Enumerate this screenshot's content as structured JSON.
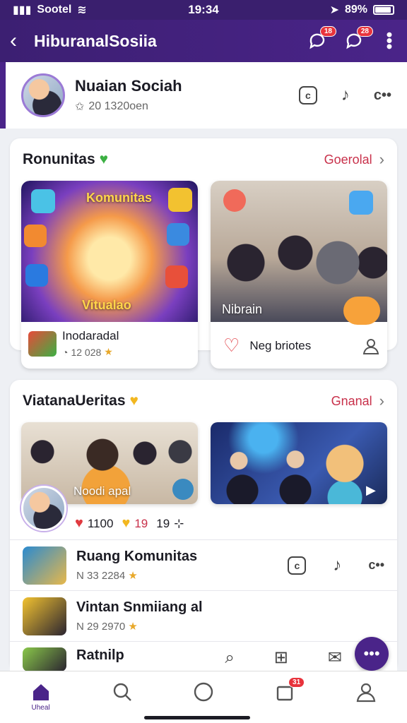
{
  "status_bar": {
    "carrier": "Sootel",
    "time": "19:34",
    "battery": "89%"
  },
  "app_bar": {
    "title": "HiburanalSosiia",
    "notif_badge_1": "18",
    "notif_badge_2": "28"
  },
  "profile": {
    "name": "Nuaian Sociah",
    "followers": "20 1320oen"
  },
  "komunitas": {
    "title": "Ronunitas",
    "link": "Goerolal",
    "card1": {
      "overlay_title": "Komunitas",
      "overlay_sub": "Vitualao",
      "title": "Inodaradal",
      "meta": "12 028"
    },
    "card2": {
      "overlay_label": "Nibrain",
      "action_label": "Neg briotes"
    }
  },
  "vitalitas": {
    "title": "ViatanaUeritas",
    "link": "Gnanal",
    "card1_label": "Noodi apal",
    "reactions": {
      "hearts": "1100",
      "smiles": "19",
      "share": "19"
    }
  },
  "list": [
    {
      "title": "Ruang Komunitas",
      "meta": "N 33 2284"
    },
    {
      "title": "Vintan Snmiiang al",
      "meta": "N 29 2970"
    },
    {
      "title": "Ratnilp",
      "meta": ""
    }
  ],
  "bottom_nav": {
    "home_label": "Uheal",
    "notif_badge": "31"
  },
  "colors": {
    "primary": "#4a2489",
    "accent": "#c8304a",
    "heart": "#e03a40"
  }
}
